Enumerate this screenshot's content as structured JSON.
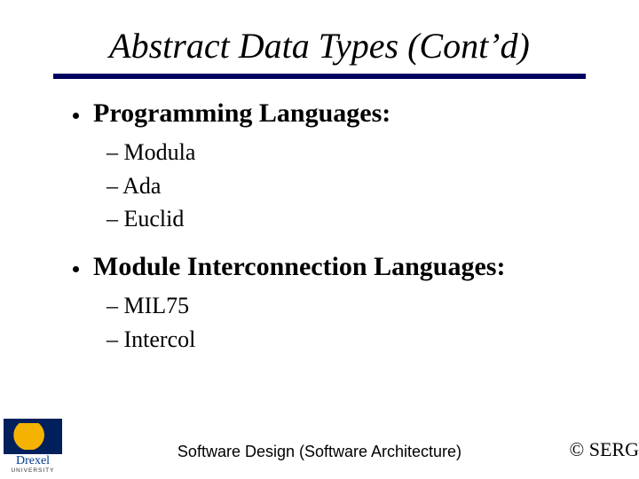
{
  "title": "Abstract Data Types (Cont’d)",
  "sections": [
    {
      "heading": "Programming Languages:",
      "items": [
        "Modula",
        "Ada",
        "Euclid"
      ]
    },
    {
      "heading": "Module Interconnection Languages:",
      "items": [
        "MIL75",
        "Intercol"
      ]
    }
  ],
  "logo": {
    "name": "Drexel",
    "sub": "UNIVERSITY"
  },
  "footer_center": "Software Design (Software Architecture)",
  "footer_right": "© SERG"
}
